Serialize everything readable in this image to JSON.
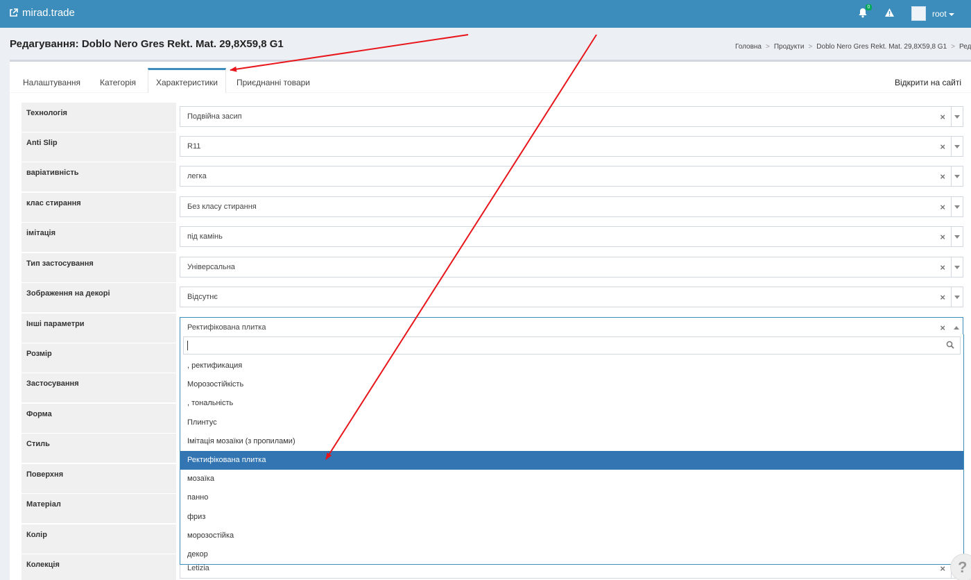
{
  "navbar": {
    "brand": "mirad.trade",
    "notifications_count": "0",
    "user": "root"
  },
  "page": {
    "title": "Редагування: Doblo Nero Gres Rekt. Mat. 29,8X59,8 G1",
    "breadcrumb": [
      "Головна",
      "Продукти",
      "Doblo Nero Gres Rekt. Mat. 29,8X59,8 G1",
      "Редагування"
    ]
  },
  "tabs": [
    {
      "label": "Налаштування"
    },
    {
      "label": "Категорія"
    },
    {
      "label": "Характеристики"
    },
    {
      "label": "Приєднанні товари"
    }
  ],
  "open_site": "Відкрити на сайті",
  "rows": [
    {
      "label": "Технологія",
      "value": "Подвійна засип"
    },
    {
      "label": "Anti Slip",
      "value": "R11"
    },
    {
      "label": "варіативність",
      "value": "легка"
    },
    {
      "label": "клас стирання",
      "value": "Без класу стирання"
    },
    {
      "label": "імітація",
      "value": "під камінь"
    },
    {
      "label": "Тип застосування",
      "value": "Універсальна"
    },
    {
      "label": "Зображення на декорі",
      "value": "Відсутнє"
    },
    {
      "label": "Інші параметри",
      "value": "Ректифікована плитка"
    },
    {
      "label": "Розмір",
      "value": ""
    },
    {
      "label": "Застосування",
      "value": ""
    },
    {
      "label": "Форма",
      "value": ""
    },
    {
      "label": "Стиль",
      "value": ""
    },
    {
      "label": "Поверхня",
      "value": ""
    },
    {
      "label": "Матеріал",
      "value": ""
    },
    {
      "label": "Колір",
      "value": ""
    },
    {
      "label": "Колекція",
      "value": "Letizia"
    }
  ],
  "dropdown": {
    "search_value": "",
    "options": [
      ", ректификация",
      "Морозостійкість",
      ", тональність",
      "Плинтус",
      "Імітація мозаїки (з пропилами)",
      "Ректифікована плитка",
      "мозаїка",
      "панно",
      "фриз",
      "морозостійка",
      "декор"
    ],
    "selected": "Ректифікована плитка"
  },
  "help_glyph": "?",
  "colors": {
    "navbar": "#3c8dbc",
    "selected_option": "#3275b2",
    "annotation_arrow": "#e8161b"
  }
}
